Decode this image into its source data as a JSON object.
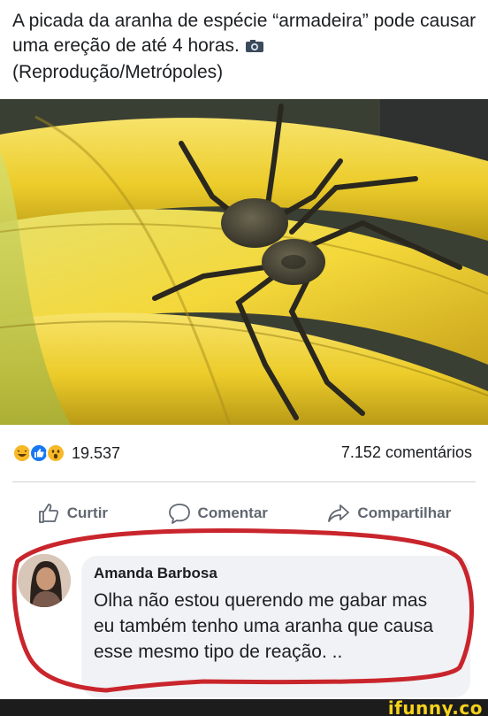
{
  "post": {
    "caption": "A picada da aranha de espécie “armadeira” pode causar uma ereção de até 4 horas.",
    "source": "(Reprodução/Metrópoles)",
    "caption_icon": "camera-icon"
  },
  "stats": {
    "reaction_icons": [
      "laugh-emoji-icon",
      "like-icon",
      "wow-emoji-icon"
    ],
    "reactions_count": "19.537",
    "comments_count": "7.152 comentários"
  },
  "actions": {
    "like_label": "Curtir",
    "comment_label": "Comentar",
    "share_label": "Compartilhar"
  },
  "comment": {
    "author": "Amanda Barbosa",
    "text": "Olha não estou querendo me gabar mas eu também tenho uma aranha que causa esse mesmo tipo de reação. .."
  },
  "watermark": "ifunny.co",
  "colors": {
    "facebook_blue": "#1877f2",
    "highlight_red": "#c9252c",
    "banana_yellow": "#f2d33c",
    "watermark_yellow": "#f6d21c"
  }
}
